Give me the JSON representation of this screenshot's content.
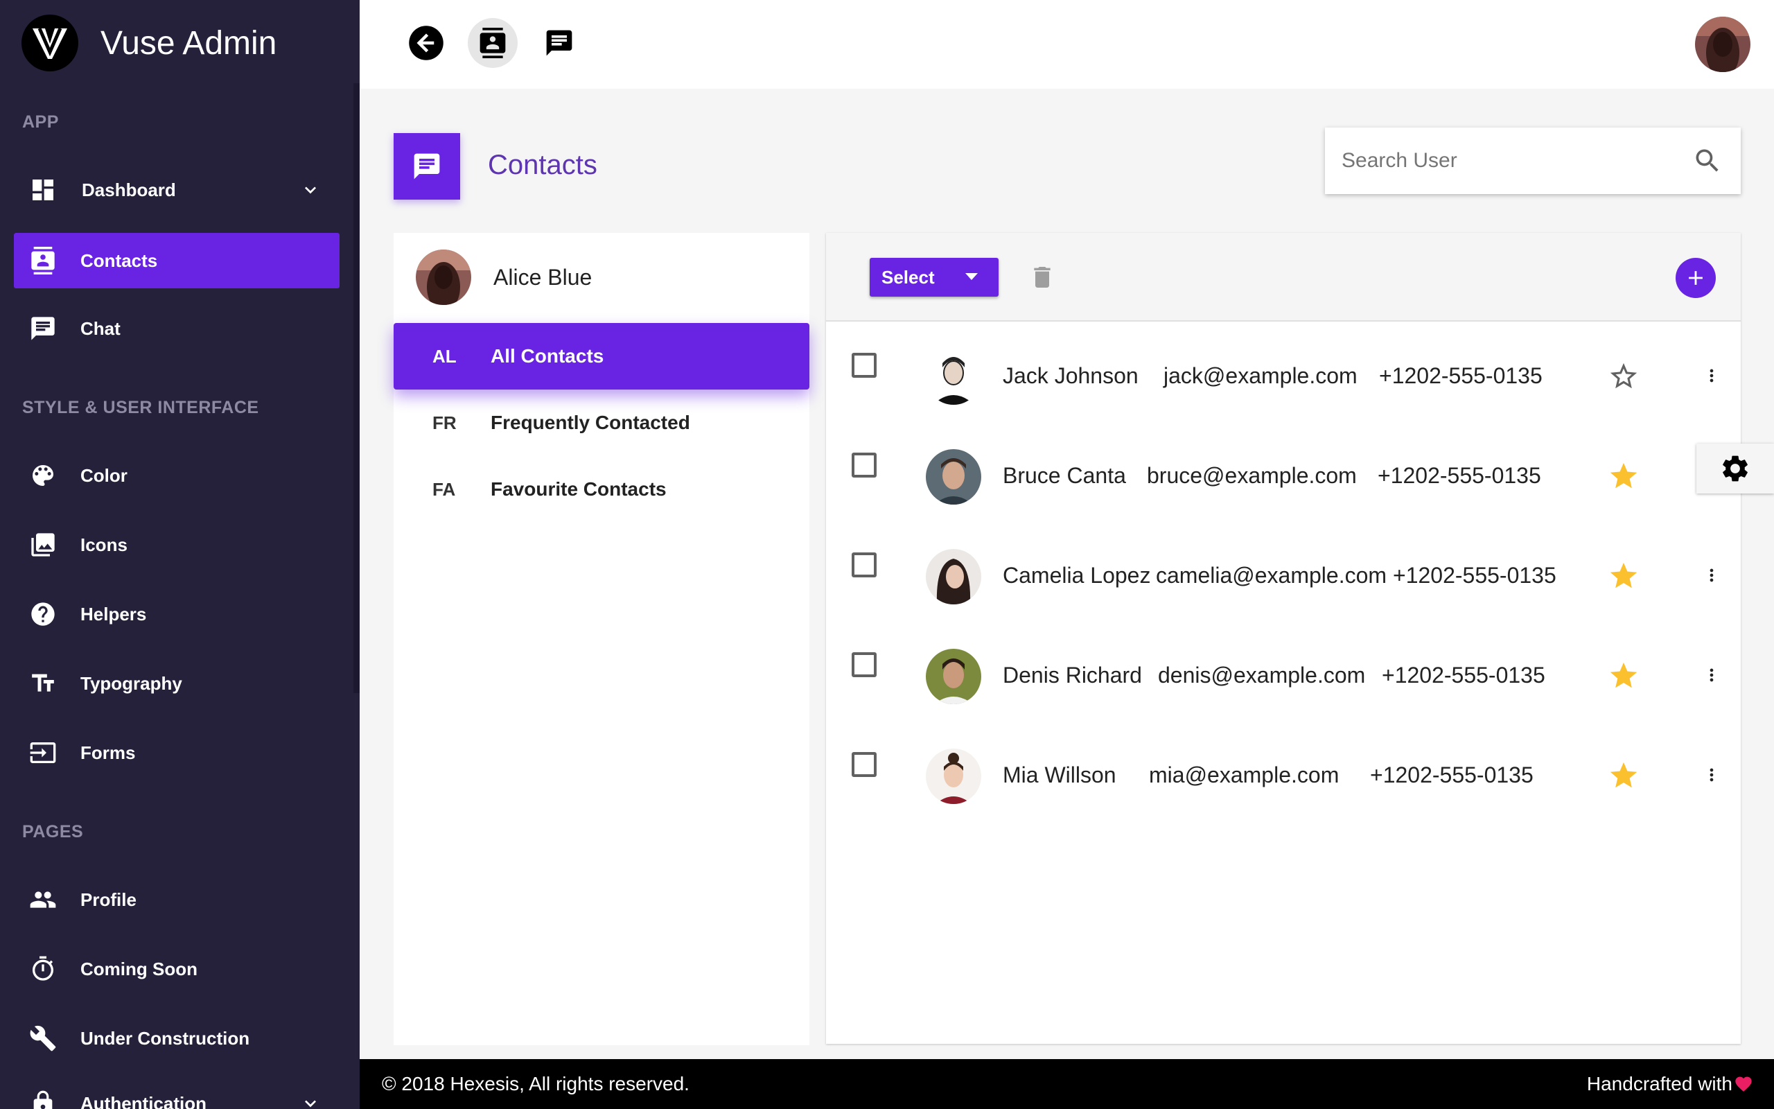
{
  "app": {
    "title": "Vuse Admin"
  },
  "sidebar": {
    "sections": {
      "app": "APP",
      "style": "STYLE & USER INTERFACE",
      "pages": "PAGES"
    },
    "items": [
      {
        "label": "Dashboard",
        "icon": "dashboard-icon"
      },
      {
        "label": "Contacts",
        "icon": "contacts-icon",
        "active": true
      },
      {
        "label": "Chat",
        "icon": "chat-icon"
      },
      {
        "label": "Color",
        "icon": "palette-icon"
      },
      {
        "label": "Icons",
        "icon": "image-icon"
      },
      {
        "label": "Helpers",
        "icon": "help-icon"
      },
      {
        "label": "Typography",
        "icon": "text-fields-icon"
      },
      {
        "label": "Forms",
        "icon": "input-icon"
      },
      {
        "label": "Profile",
        "icon": "people-icon"
      },
      {
        "label": "Coming Soon",
        "icon": "timer-icon"
      },
      {
        "label": "Under Construction",
        "icon": "wrench-icon"
      },
      {
        "label": "Authentication",
        "icon": "lock-icon"
      }
    ]
  },
  "page": {
    "title": "Contacts"
  },
  "search": {
    "placeholder": "Search User"
  },
  "owner": {
    "name": "Alice Blue"
  },
  "filters": [
    {
      "abbr": "AL",
      "label": "All Contacts",
      "active": true
    },
    {
      "abbr": "FR",
      "label": "Frequently Contacted"
    },
    {
      "abbr": "FA",
      "label": "Favourite Contacts"
    }
  ],
  "toolbar": {
    "select_label": "Select"
  },
  "contacts": [
    {
      "name": "Jack Johnson",
      "email": "jack@example.com",
      "phone": "+1202-555-0135",
      "favourite": false
    },
    {
      "name": "Bruce Canta",
      "email": "bruce@example.com",
      "phone": "+1202-555-0135",
      "favourite": true
    },
    {
      "name": "Camelia Lopez",
      "email": "camelia@example.com",
      "phone": "+1202-555-0135",
      "favourite": true
    },
    {
      "name": "Denis Richard",
      "email": "denis@example.com",
      "phone": "+1202-555-0135",
      "favourite": true
    },
    {
      "name": "Mia Willson",
      "email": "mia@example.com",
      "phone": "+1202-555-0135",
      "favourite": true
    }
  ],
  "footer": {
    "copyright": "© 2018 Hexesis, All rights reserved.",
    "handcrafted": "Handcrafted with"
  },
  "colors": {
    "accent": "#6824e2",
    "sidebar": "#25213b",
    "star": "#fbc02d",
    "heart": "#e91e63"
  }
}
